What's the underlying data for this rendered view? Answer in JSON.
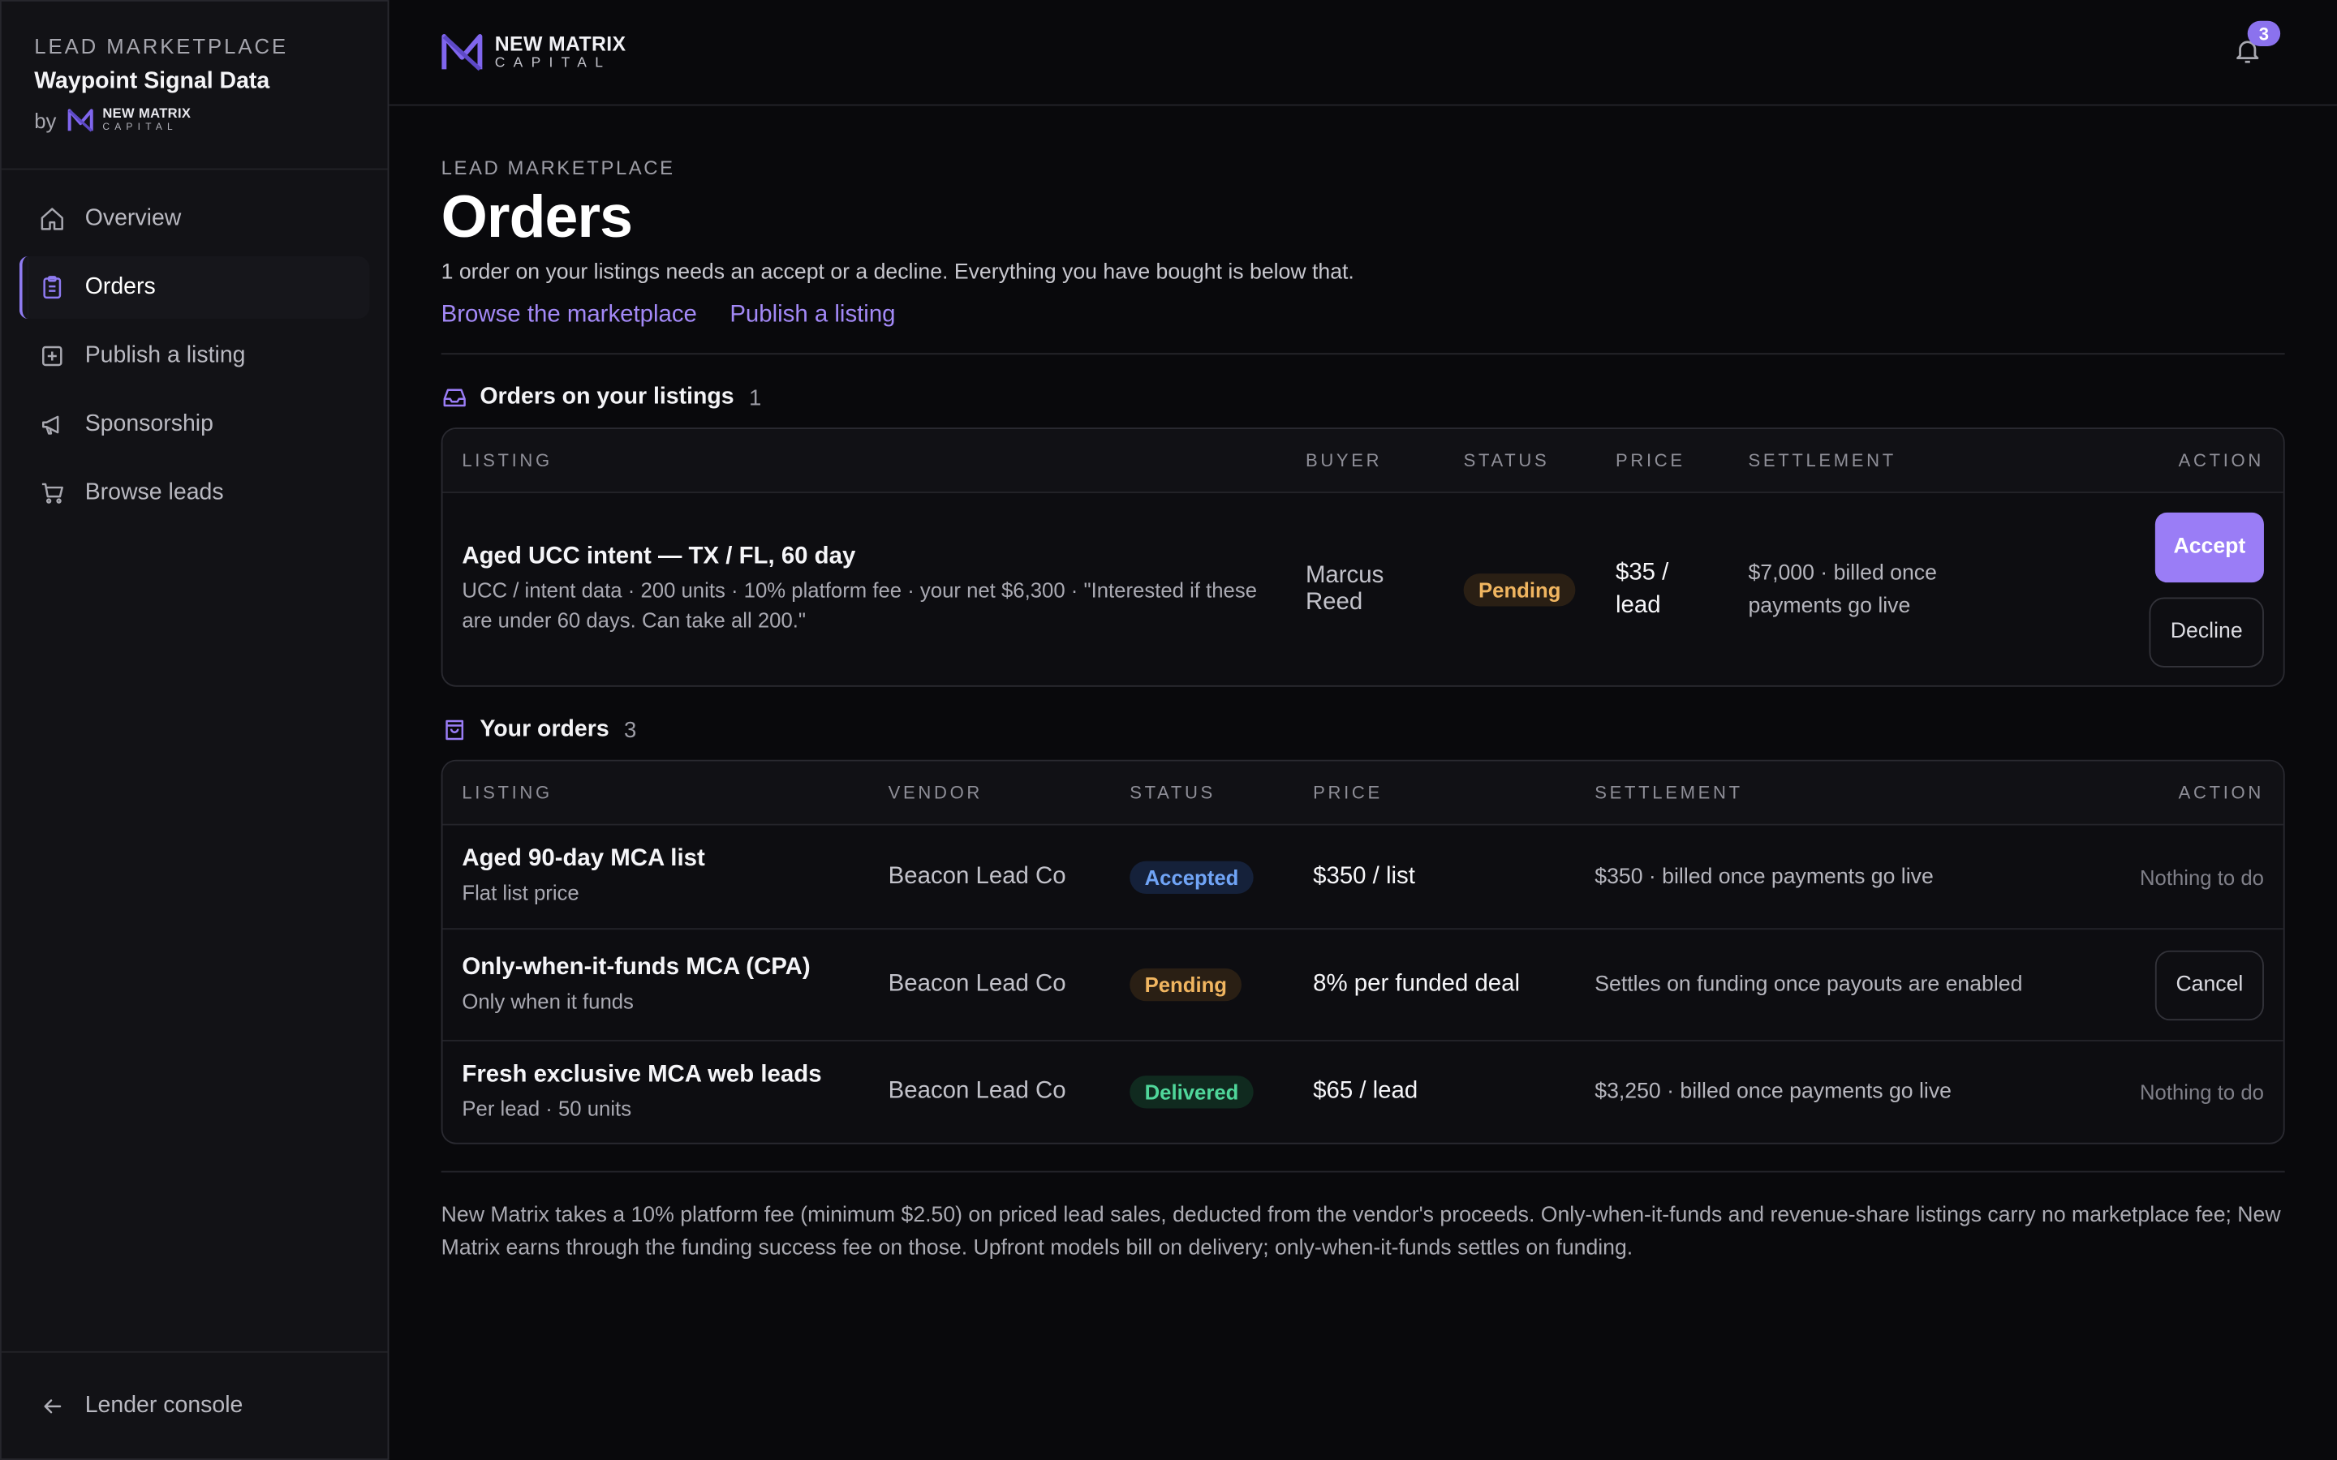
{
  "sidebar": {
    "kicker": "LEAD MARKETPLACE",
    "workspace": "Waypoint Signal Data",
    "by": "by",
    "mini_logo_line1": "NEW MATRIX",
    "mini_logo_line2": "CAPITAL",
    "items": [
      {
        "label": "Overview",
        "icon": "home-icon"
      },
      {
        "label": "Orders",
        "icon": "clipboard-icon",
        "active": true
      },
      {
        "label": "Publish a listing",
        "icon": "plus-square-icon"
      },
      {
        "label": "Sponsorship",
        "icon": "megaphone-icon"
      },
      {
        "label": "Browse leads",
        "icon": "cart-icon"
      }
    ],
    "footer_label": "Lender console"
  },
  "topbar": {
    "logo_line1": "NEW MATRIX",
    "logo_line2": "CAPITAL",
    "notifications": "3"
  },
  "page": {
    "kicker": "LEAD MARKETPLACE",
    "title": "Orders",
    "lede": "1 order on your listings needs an accept or a decline. Everything you have bought is below that.",
    "link_browse": "Browse the marketplace",
    "link_publish": "Publish a listing"
  },
  "listings_orders": {
    "title": "Orders on your listings",
    "count": "1",
    "headers": {
      "listing": "LISTING",
      "buyer": "BUYER",
      "status": "STATUS",
      "price": "PRICE",
      "settlement": "SETTLEMENT",
      "action": "ACTION"
    },
    "rows": [
      {
        "title": "Aged UCC intent — TX / FL, 60 day",
        "sub": "UCC / intent data · 200 units · 10% platform fee · your net $6,300 · \"Interested if these are under 60 days. Can take all 200.\"",
        "buyer": "Marcus Reed",
        "status": "Pending",
        "price": "$35 / lead",
        "settlement": "$7,000 · billed once payments go live",
        "accept": "Accept",
        "decline": "Decline"
      }
    ]
  },
  "your_orders": {
    "title": "Your orders",
    "count": "3",
    "headers": {
      "listing": "LISTING",
      "vendor": "VENDOR",
      "status": "STATUS",
      "price": "PRICE",
      "settlement": "SETTLEMENT",
      "action": "ACTION"
    },
    "rows": [
      {
        "title": "Aged 90-day MCA list",
        "sub": "Flat list price",
        "vendor": "Beacon Lead Co",
        "status": "Accepted",
        "price": "$350 / list",
        "settlement": "$350 · billed once payments go live",
        "action": "Nothing to do"
      },
      {
        "title": "Only-when-it-funds MCA (CPA)",
        "sub": "Only when it funds",
        "vendor": "Beacon Lead Co",
        "status": "Pending",
        "price": "8% per funded deal",
        "settlement": "Settles on funding once payouts are enabled",
        "action": "Cancel"
      },
      {
        "title": "Fresh exclusive MCA web leads",
        "sub": "Per lead · 50 units",
        "vendor": "Beacon Lead Co",
        "status": "Delivered",
        "price": "$65 / lead",
        "settlement": "$3,250 · billed once payments go live",
        "action": "Nothing to do"
      }
    ]
  },
  "footnote": "New Matrix takes a 10% platform fee (minimum $2.50) on priced lead sales, deducted from the vendor's proceeds. Only-when-it-funds and revenue-share listings carry no marketplace fee; New Matrix earns through the funding success fee on those. Upfront models bill on delivery; only-when-it-funds settles on funding.",
  "colors": {
    "accent": "#9a7df6",
    "pending": "#f0b560",
    "accepted": "#70a4f6",
    "delivered": "#4fd69a",
    "background": "#09090c"
  }
}
